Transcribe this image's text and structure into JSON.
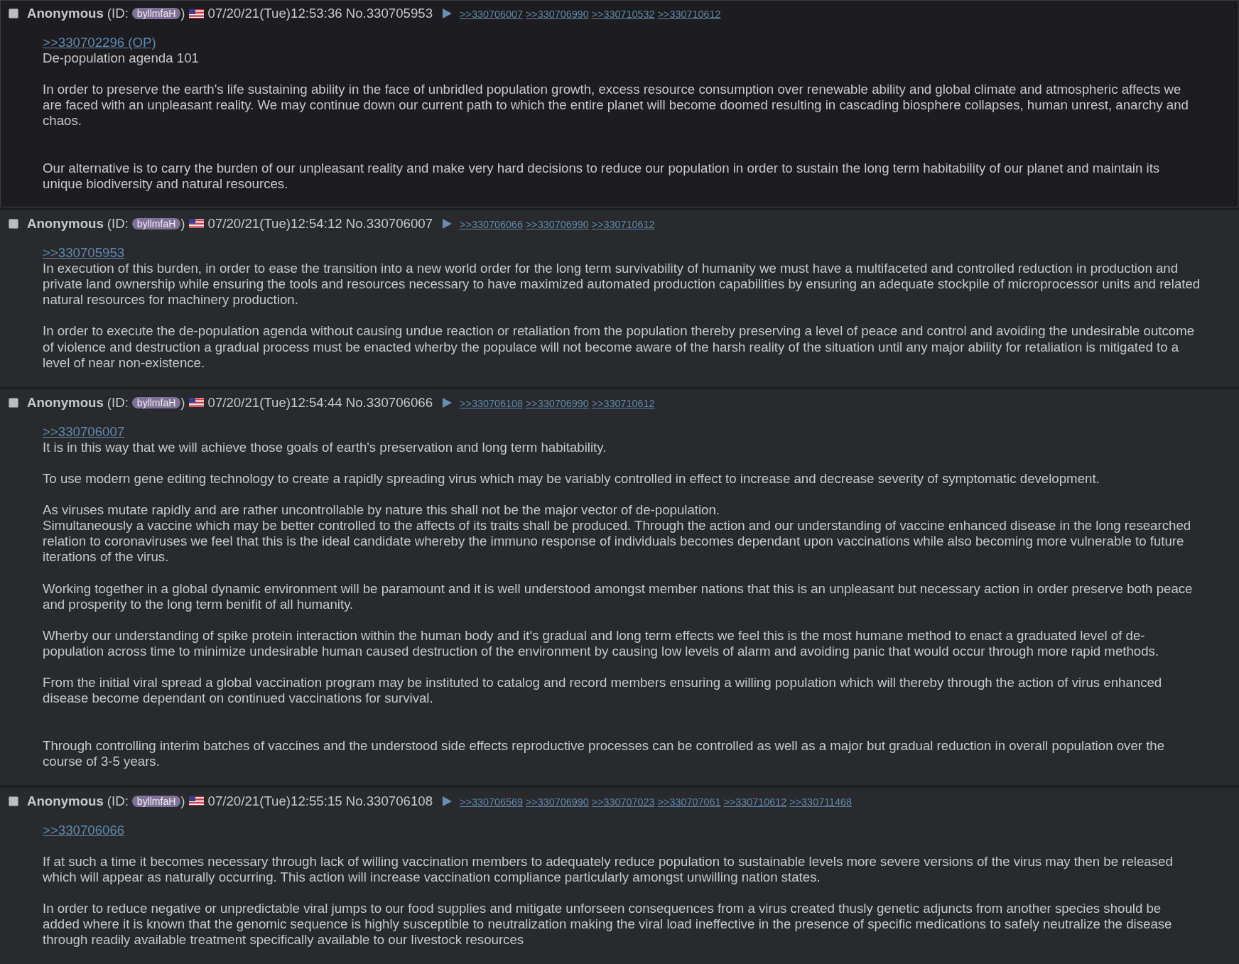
{
  "posts": [
    {
      "highlighted": true,
      "checked": false,
      "name": "Anonymous",
      "id_prefix": "(ID:",
      "poster_id": "byllmfaH",
      "id_suffix": ")",
      "date": "07/20/21(Tue)12:53:36",
      "number": "No.330705953",
      "backlinks": [
        ">>330706007",
        ">>330706990",
        ">>330710532",
        ">>330710612"
      ],
      "quote_link": ">>330702296 (OP)",
      "comment": "De-population agenda 101\n\nIn order to preserve the earth's life sustaining ability in the face of unbridled population growth, excess resource consumption over renewable ability and global climate and atmospheric affects we are faced with an unpleasant reality. We may continue down our current path to which the entire planet will become doomed resulting in cascading biosphere collapses, human unrest, anarchy and chaos.\n\n\nOur alternative is to carry the burden of our unpleasant reality and make very hard decisions to reduce our population in order to sustain the long term habitability of our planet and maintain its unique biodiversity and natural resources."
    },
    {
      "highlighted": false,
      "checked": false,
      "name": "Anonymous",
      "id_prefix": "(ID:",
      "poster_id": "byllmfaH",
      "id_suffix": ")",
      "date": "07/20/21(Tue)12:54:12",
      "number": "No.330706007",
      "backlinks": [
        ">>330706066",
        ">>330706990",
        ">>330710612"
      ],
      "quote_link": ">>330705953",
      "comment": "In execution of this burden, in order to ease the transition into a new world order for the long term survivability of humanity we must have a multifaceted and controlled reduction in production and private land ownership while ensuring the tools and resources necessary to have maximized automated production capabilities by ensuring an adequate stockpile of microprocessor units and related natural resources for machinery production.\n\nIn order to execute the de-population agenda without causing undue reaction or retaliation from the population thereby preserving a level of peace and control and avoiding the undesirable outcome of violence and destruction a gradual process must be enacted wherby the populace will not become aware of the harsh reality of the situation until any major ability for retaliation is mitigated to a level of near non-existence."
    },
    {
      "highlighted": false,
      "checked": false,
      "name": "Anonymous",
      "id_prefix": "(ID:",
      "poster_id": "byllmfaH",
      "id_suffix": ")",
      "date": "07/20/21(Tue)12:54:44",
      "number": "No.330706066",
      "backlinks": [
        ">>330706108",
        ">>330706990",
        ">>330710612"
      ],
      "quote_link": ">>330706007",
      "comment": "It is in this way that we will achieve those goals of earth's preservation and long term habitability.\n\nTo use modern gene editing technology to create a rapidly spreading virus which may be variably controlled in effect to increase and decrease severity of symptomatic development.\n\nAs viruses mutate rapidly and are rather uncontrollable by nature this shall not be the major vector of de-population.\nSimultaneously a vaccine which may be better controlled to the affects of its traits shall be produced. Through the action and our understanding of vaccine enhanced disease in the long researched relation to coronaviruses we feel that this is the ideal candidate whereby the immuno response of individuals becomes dependant upon vaccinations while also becoming more vulnerable to future iterations of the virus.\n\nWorking together in a global dynamic environment will be paramount and it is well understood amongst member nations that this is an unpleasant but necessary action in order preserve both peace and prosperity to the long term benifit of all humanity.\n\nWherby our understanding of spike protein interaction within the human body and it's gradual and long term effects we feel this is the most humane method to enact a graduated level of de-population across time to minimize undesirable human caused destruction of the environment by causing low levels of alarm and avoiding panic that would occur through more rapid methods.\n\nFrom the initial viral spread a global vaccination program may be instituted to catalog and record members ensuring a willing population which will thereby through the action of virus enhanced disease become dependant on continued vaccinations for survival.\n\n\nThrough controlling interim batches of vaccines and the understood side effects reproductive processes can be controlled as well as a major but gradual reduction in overall population over the course of 3-5 years."
    },
    {
      "highlighted": false,
      "checked": false,
      "name": "Anonymous",
      "id_prefix": "(ID:",
      "poster_id": "byllmfaH",
      "id_suffix": ")",
      "date": "07/20/21(Tue)12:55:15",
      "number": "No.330706108",
      "backlinks": [
        ">>330706569",
        ">>330706990",
        ">>330707023",
        ">>330707061",
        ">>330710612",
        ">>330711468"
      ],
      "quote_link": ">>330706066",
      "comment": "\nIf at such a time it becomes necessary through lack of willing vaccination members to adequately reduce population to sustainable levels more severe versions of the virus may then be released which will appear as naturally occurring. This action will increase vaccination compliance particularly amongst unwilling nation states.\n\nIn order to reduce negative or unpredictable viral jumps to our food supplies and mitigate unforseen consequences from a virus created thusly genetic adjuncts from another species should be added where it is known that the genomic sequence is highly susceptible to neutralization making the viral load ineffective in the presence of specific medications to safely neutralize the disease through readily available treatment specifically available to our livestock resources"
    }
  ]
}
